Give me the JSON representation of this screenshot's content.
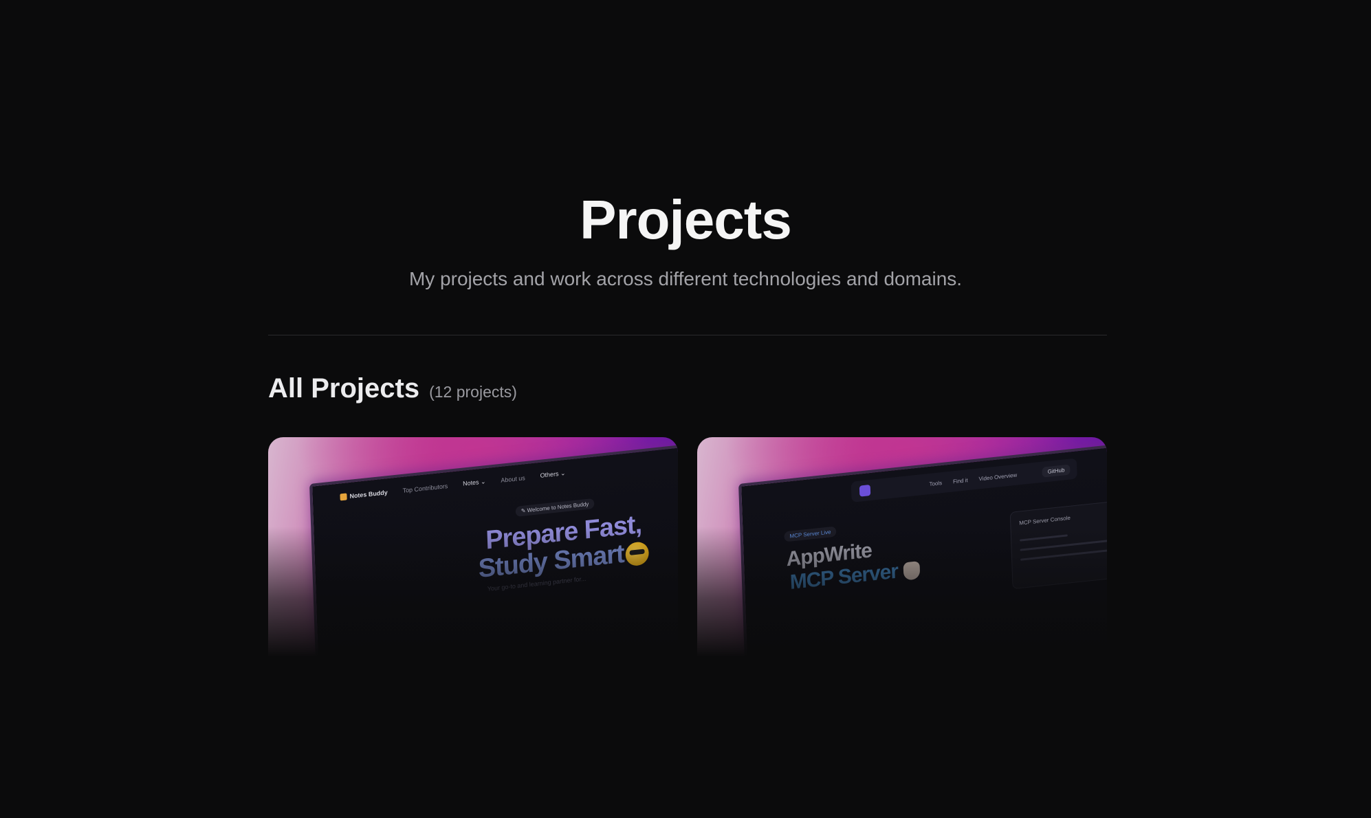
{
  "page": {
    "title": "Projects",
    "subtitle": "My projects and work across different technologies and domains."
  },
  "section": {
    "title": "All Projects",
    "count_label": "(12 projects)"
  },
  "colors": {
    "background": "#0b0b0c",
    "card_gradient_pink": "#c13592",
    "card_gradient_purple": "#5a12a6"
  },
  "projects": [
    {
      "preview": {
        "brand": "Notes Buddy",
        "brand_icon": "notes-buddy-logo-icon",
        "nav": [
          "Top Contributors",
          "Notes ⌄",
          "About us",
          "Others ⌄"
        ],
        "welcome_pill": "✎ Welcome to Notes Buddy",
        "headline_line1": "Prepare Fast,",
        "headline_line2": "Study Smart",
        "headline_emoji": "sunglasses-face-icon",
        "tagline": "Your go-to and learning partner for..."
      }
    },
    {
      "preview": {
        "app_icon": "appwrite-mcp-logo-icon",
        "nav": [
          "Tools",
          "Find it",
          "Video Overview"
        ],
        "github_label": "GitHub",
        "badge": "MCP Server Live",
        "headline_line1": "AppWrite",
        "headline_line2": "MCP Server",
        "headline_emoji": "waving-hand-icon",
        "console_title": "MCP Server Console"
      }
    }
  ]
}
